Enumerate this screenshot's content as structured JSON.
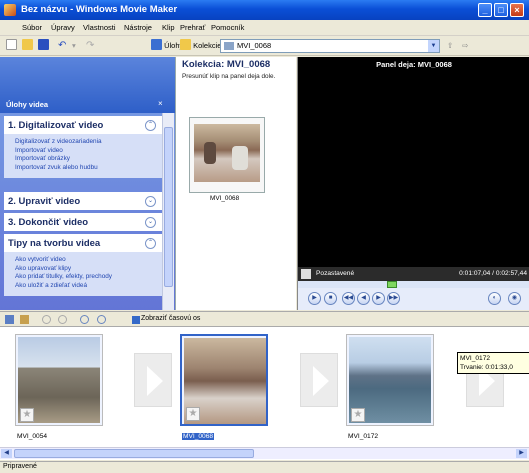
{
  "window": {
    "title": "Bez názvu - Windows Movie Maker"
  },
  "menu": [
    "Súbor",
    "Úpravy",
    "Vlastnosti",
    "Nástroje",
    "Klip",
    "Prehrať",
    "Pomocník"
  ],
  "toolbar": {
    "tasks_label": "Úlohy",
    "collections_label": "Kolekcie",
    "collection_value": "MVI_0068"
  },
  "tasks_pane": {
    "header": "Úlohy videa",
    "sections": [
      {
        "title": "1. Digitalizovať video",
        "items": [
          "Digitalizovať z videozariadenia",
          "Importovať video",
          "Importovať obrázky",
          "Importovať zvuk alebo hudbu"
        ]
      },
      {
        "title": "2. Upraviť video",
        "items": []
      },
      {
        "title": "3. Dokončiť video",
        "items": []
      },
      {
        "title": "Tipy na tvorbu videa",
        "items": [
          "Ako vytvoriť video",
          "Ako upravovať klipy",
          "Ako pridať titulky, efekty, prechody",
          "Ako uložiť a zdieľať videá"
        ]
      }
    ]
  },
  "collection": {
    "title": "Kolekcia: MVI_0068",
    "hint": "Presunúť klip na panel deja dole.",
    "clip_name": "MVI_0068"
  },
  "monitor": {
    "title": "Panel deja: MVI_0068",
    "state": "Pozastavené",
    "time": "0:01:07,04 / 0:02:57,44",
    "progress_percent": 40
  },
  "timeline_toolbar": {
    "show_timeline": "Zobraziť časovú os"
  },
  "storyboard": {
    "clips": [
      "MVI_0054",
      "MVI_0068",
      "MVI_0172"
    ],
    "tooltip": {
      "name": "MVI_0172",
      "duration": "Trvanie: 0:01:33,0"
    }
  },
  "status": "Pripravené"
}
